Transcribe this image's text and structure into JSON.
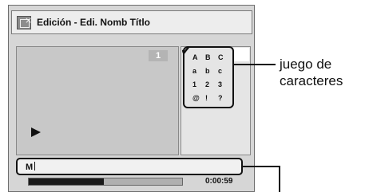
{
  "title_bar": {
    "title": "Edición - Edi. Nomb Títlo",
    "icon": "title-edit-icon"
  },
  "preview": {
    "chapter_number": "1",
    "status_icon": "play-icon"
  },
  "character_set": {
    "selected_icon": "check-icon",
    "rows": [
      [
        "A",
        "B",
        "C"
      ],
      [
        "a",
        "b",
        "c"
      ],
      [
        "1",
        "2",
        "3"
      ],
      [
        "@",
        "!",
        "?"
      ]
    ]
  },
  "name_input": {
    "value": "M"
  },
  "progress": {
    "fraction": 0.49,
    "time": "0:00:59"
  },
  "callouts": {
    "character_set_label_line1": "juego de",
    "character_set_label_line2": "caracteres"
  }
}
